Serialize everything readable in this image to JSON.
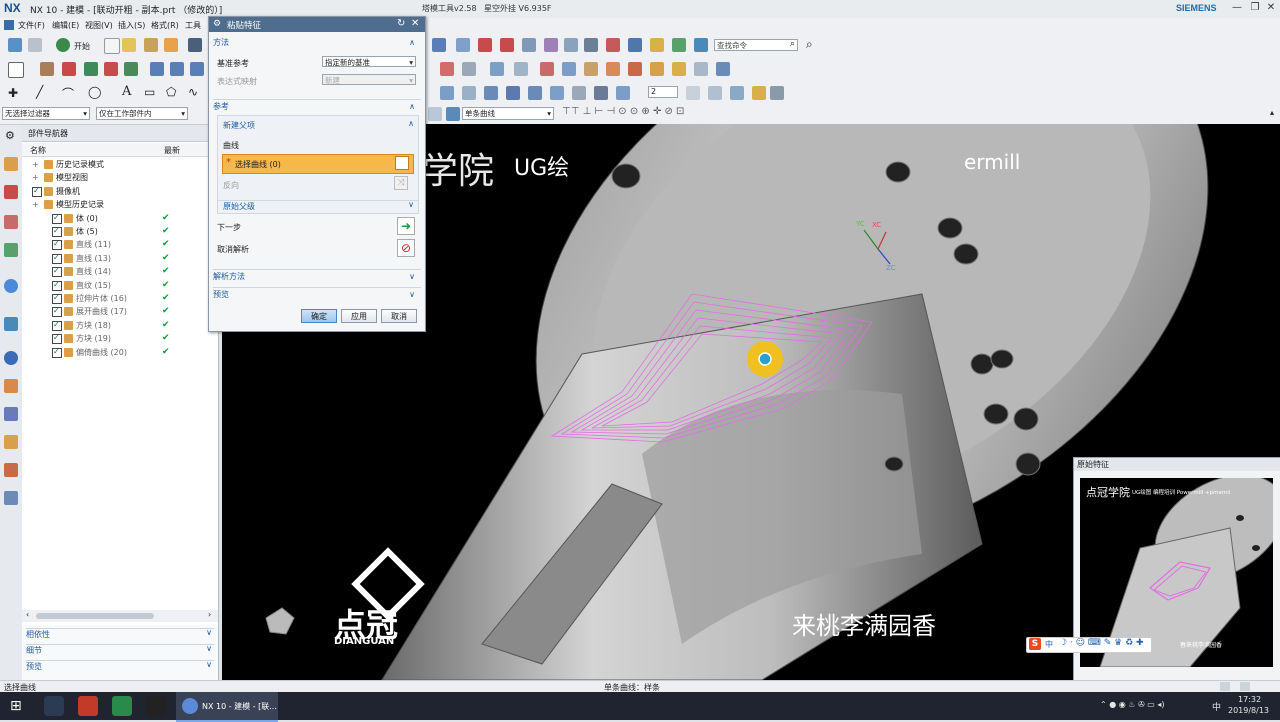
{
  "window": {
    "app_logo": "NX",
    "title": "NX 10 - 建模 - [联动开粗 - 副本.prt （修改的）]",
    "extra_tool_1": "塔模工具v2.58",
    "extra_tool_2": "星空外挂 V6.935F",
    "brand": "SIEMENS"
  },
  "menu": [
    "文件(F)",
    "编辑(E)",
    "视图(V)",
    "插入(S)",
    "格式(R)",
    "工具(T)"
  ],
  "toolbar": {
    "start_label": "开始",
    "search_command": "查找命令",
    "filter_none": "无选择过滤器",
    "scope": "仅在工作部件内",
    "curve_rule": "单条曲线",
    "layer_value": "2"
  },
  "navigator": {
    "title": "部件导航器",
    "col_name": "名称",
    "col_latest": "最新",
    "rows": [
      {
        "label": "历史记录模式",
        "level": 1,
        "checked": false,
        "latest": false
      },
      {
        "label": "模型视图",
        "level": 1,
        "checked": false,
        "latest": false
      },
      {
        "label": "摄像机",
        "level": 1,
        "checked": true,
        "latest": false
      },
      {
        "label": "模型历史记录",
        "level": 1,
        "checked": false,
        "latest": false
      },
      {
        "label": "体 (0)",
        "level": 2,
        "checked": true,
        "latest": true
      },
      {
        "label": "体 (5)",
        "level": 2,
        "checked": true,
        "latest": true
      },
      {
        "label": "直线 (11)",
        "level": 2,
        "checked": true,
        "latest": true
      },
      {
        "label": "直线 (13)",
        "level": 2,
        "checked": true,
        "latest": true
      },
      {
        "label": "直线 (14)",
        "level": 2,
        "checked": true,
        "latest": true
      },
      {
        "label": "直纹 (15)",
        "level": 2,
        "checked": true,
        "latest": true
      },
      {
        "label": "拉伸片体 (16)",
        "level": 2,
        "checked": true,
        "latest": true
      },
      {
        "label": "展开曲线 (17)",
        "level": 2,
        "checked": true,
        "latest": true
      },
      {
        "label": "方块 (18)",
        "level": 2,
        "checked": true,
        "latest": true
      },
      {
        "label": "方块 (19)",
        "level": 2,
        "checked": true,
        "latest": true
      },
      {
        "label": "偏倚曲线 (20)",
        "level": 2,
        "checked": true,
        "latest": true
      }
    ],
    "sections": [
      "相依性",
      "细节",
      "预览"
    ]
  },
  "dialog": {
    "title": "粘贴特征",
    "method_header": "方法",
    "datum_ref_label": "基准参考",
    "datum_ref_value": "指定新的基准",
    "expr_map_label": "表达式映射",
    "expr_map_value": "新建",
    "reference_header": "参考",
    "new_parent_header": "新建父项",
    "curve_label": "曲线",
    "select_curve": "选择曲线 (0)",
    "reverse_label": "反向",
    "original_parent": "原始父级",
    "next_step": "下一步",
    "cancel_parse": "取消解析",
    "parse_method": "解析方法",
    "preview": "预览",
    "ok": "确定",
    "apply": "应用",
    "cancel": "取消"
  },
  "viewport": {
    "watermark_academy": "学院",
    "watermark_ug": "UG绘",
    "watermark_powermill": "ermill",
    "watermark_slogan": "来桃李满园香",
    "watermark_brand": "点冠",
    "watermark_brand_en": "DIANGUAN",
    "axis_xc": "XC",
    "axis_yc": "YC",
    "axis_zc": "ZC"
  },
  "preview_panel": {
    "title": "原始特征",
    "img_academy": "点冠学院",
    "img_caption": "UG绘图 编程培训 Powermill +pmemil",
    "img_bottom": "春来桃李满园香"
  },
  "status": {
    "left": "选择曲线",
    "center": "单条曲线：样条"
  },
  "taskbar": {
    "active_app": "NX 10 - 建模 - [联...",
    "ime": "中",
    "time": "17:32",
    "date": "2019/8/13"
  }
}
